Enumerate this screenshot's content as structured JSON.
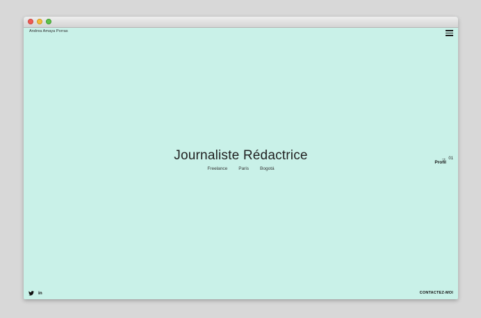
{
  "site": {
    "brand": "Andrea Amaya Porras",
    "menu_icon": "hamburger-menu-icon"
  },
  "hero": {
    "title": "Journaliste Rédactrice",
    "tags": [
      "Freelance",
      "Paris",
      "Bogotá"
    ]
  },
  "next_section": {
    "arrow_icon": "arrow-right-icon",
    "number": "01",
    "label": "Profil"
  },
  "social": {
    "twitter_icon": "twitter-icon",
    "linkedin_label": "in"
  },
  "contact": {
    "label": "CONTACTEZ-MOI"
  },
  "colors": {
    "background": "#c9f1e8",
    "text": "#1f1f1f"
  }
}
